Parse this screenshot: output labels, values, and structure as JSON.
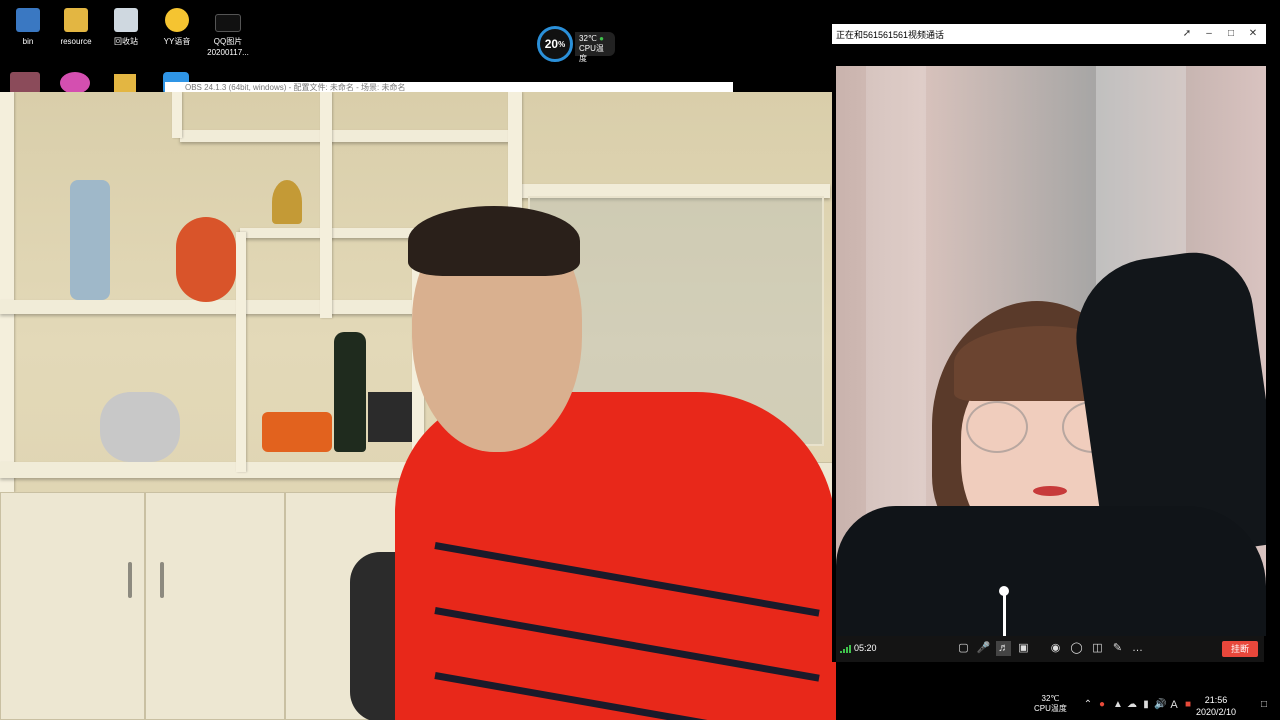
{
  "desktop": {
    "icons": [
      {
        "label": "bin",
        "icon": "user-folder-icon",
        "color": "#3a78c2"
      },
      {
        "label": "resource",
        "icon": "folder-icon",
        "color": "#e3b642"
      },
      {
        "label": "回收站",
        "icon": "recycle-bin-icon",
        "color": "#cfd8e0"
      },
      {
        "label": "YY语音",
        "icon": "yy-voice-icon",
        "color": "#f5c431"
      },
      {
        "label": "QQ图片",
        "sublabel": "20200117...",
        "icon": "image-file-icon",
        "color": "#111111"
      }
    ]
  },
  "cpu_widget": {
    "usage": "20",
    "usage_unit": "%",
    "temp": "32℃",
    "label": "CPU温度"
  },
  "obs_window": {
    "title": "OBS 24.1.3 (64bit, windows) - 配置文件: 未命名 - 场景: 未命名"
  },
  "call_window": {
    "title": "正在和561561561视频通话",
    "timer": "05:20",
    "hangup_label": "挂断",
    "controls": [
      "chat-icon",
      "microphone-icon",
      "speaker-icon",
      "camera-icon",
      "screenshot-icon",
      "record-icon",
      "layout-icon",
      "edit-icon",
      "more-icon"
    ]
  },
  "taskbar": {
    "cpu_temp": "32℃",
    "cpu_label": "CPU温度",
    "time": "21:56",
    "date": "2020/2/10",
    "input_indicator": "A"
  }
}
